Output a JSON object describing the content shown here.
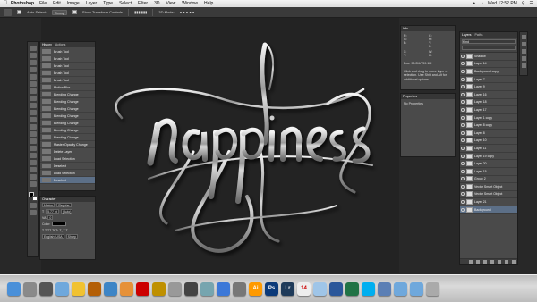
{
  "menubar": {
    "app_name": "Photoshop",
    "items": [
      "File",
      "Edit",
      "Image",
      "Layer",
      "Type",
      "Select",
      "Filter",
      "3D",
      "View",
      "Window",
      "Help"
    ],
    "clock": "Wed 12:52 PM"
  },
  "options_bar": {
    "auto_select": "Auto-Select:",
    "group": "Group",
    "show_transform": "Show Transform Controls",
    "mode": "3D Mode:"
  },
  "canvas": {
    "artwork_word": "happiness"
  },
  "history": {
    "tabs": [
      "History",
      "Actions"
    ],
    "items": [
      "Brush Tool",
      "Brush Tool",
      "Brush Tool",
      "Brush Tool",
      "Brush Tool",
      "Motion Blur",
      "Blending Change",
      "Blending Change",
      "Blending Change",
      "Blending Change",
      "Blending Change",
      "Blending Change",
      "Blending Change",
      "Master Opacity Change",
      "Delete Layer",
      "Load Selection",
      "Deselect",
      "Load Selection",
      "Deselect"
    ]
  },
  "character": {
    "tab": "Character",
    "font": "Minion",
    "style": "Regular",
    "size": "5.77 pt",
    "leading": "(Auto)",
    "tracking": "0",
    "color_label": "Color:",
    "language": "English: USA",
    "aa": "Sharp"
  },
  "info": {
    "tab": "Info",
    "r": "R:",
    "g": "G:",
    "b": "B:",
    "c": "C:",
    "m": "M:",
    "y": "Y:",
    "k": "K:",
    "x": "X:",
    "yc": "Y:",
    "w": "W:",
    "h": "H:",
    "doc": "Doc: 98.2M/759.1M",
    "message": "Click and drag to move layer or selection. Use Shift and Alt for additional options."
  },
  "properties": {
    "tab": "Properties",
    "body": "No Properties"
  },
  "layers": {
    "tabs": [
      "Layers",
      "Paths"
    ],
    "kind": "Kind",
    "items": [
      {
        "name": "Shadow",
        "sel": false
      },
      {
        "name": "Layer 14",
        "sel": false
      },
      {
        "name": "Background copy",
        "sel": false
      },
      {
        "name": "Layer 7",
        "sel": false
      },
      {
        "name": "Layer 9",
        "sel": false
      },
      {
        "name": "Layer 16",
        "sel": false
      },
      {
        "name": "Layer 18",
        "sel": false
      },
      {
        "name": "Layer 17",
        "sel": false
      },
      {
        "name": "Layer 1 copy",
        "sel": false
      },
      {
        "name": "Layer 8 copy",
        "sel": false
      },
      {
        "name": "Layer 8",
        "sel": false
      },
      {
        "name": "Layer 10",
        "sel": false
      },
      {
        "name": "Layer 11",
        "sel": false
      },
      {
        "name": "Layer 19 copy",
        "sel": false
      },
      {
        "name": "Layer 20",
        "sel": false
      },
      {
        "name": "Layer 15",
        "sel": false
      },
      {
        "name": "Group 2",
        "sel": false
      },
      {
        "name": "Vector Smart Object",
        "sel": false
      },
      {
        "name": "Vector Smart Object",
        "sel": false
      },
      {
        "name": "Layer 21",
        "sel": false
      },
      {
        "name": "Background",
        "sel": true
      }
    ]
  },
  "dock": {
    "icons": [
      "finder-icon",
      "launchpad-icon",
      "mission-control-icon",
      "mail-icon",
      "notes-icon",
      "itunes-icon",
      "safari-icon",
      "firefox-icon",
      "chrome-icon",
      "ibooks-icon",
      "preview-icon",
      "photo-booth-icon",
      "photos-icon",
      "app-store-icon",
      "system-preferences-icon",
      "illustrator-icon",
      "photoshop-icon",
      "lightroom-icon",
      "calendar-icon",
      "finder-window-icon",
      "ms-word-icon",
      "excel-icon",
      "skype-icon",
      "bluetooth-icon",
      "documents-icon",
      "downloads-icon",
      "trash-icon"
    ],
    "labels": {
      "ai": "Ai",
      "ps": "Ps",
      "lr": "Lr",
      "cal": "14"
    }
  }
}
